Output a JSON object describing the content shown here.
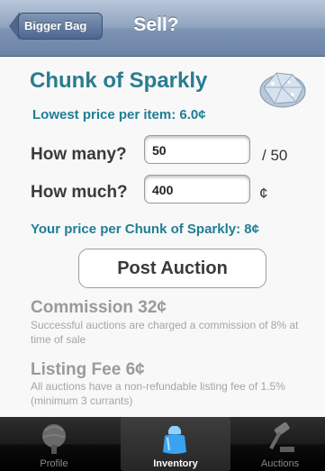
{
  "nav": {
    "back_label": "Bigger Bag",
    "title": "Sell?"
  },
  "item": {
    "name": "Chunk of Sparkly",
    "lowest_price": "Lowest price per item: 6.0¢"
  },
  "form": {
    "how_many_label": "How many?",
    "how_many_value": "50",
    "how_many_suffix": "/ 50",
    "how_much_label": "How much?",
    "how_much_value": "400",
    "how_much_suffix": "¢"
  },
  "your_price": "Your price per Chunk of Sparkly: 8¢",
  "post_button": "Post Auction",
  "commission": {
    "title": "Commission 32¢",
    "text": "Successful auctions are charged a commission of 8% at time of sale"
  },
  "listing_fee": {
    "title": "Listing Fee 6¢",
    "text": "All auctions have a non-refundable listing fee of 1.5% (minimum 3 currants)"
  },
  "tabs": [
    {
      "label": "Profile",
      "icon": "profile-icon",
      "active": false
    },
    {
      "label": "Inventory",
      "icon": "inventory-icon",
      "active": true
    },
    {
      "label": "Auctions",
      "icon": "auctions-icon",
      "active": false
    }
  ],
  "colors": {
    "accent": "#2a7c8f",
    "nav": "#6c84a7"
  }
}
